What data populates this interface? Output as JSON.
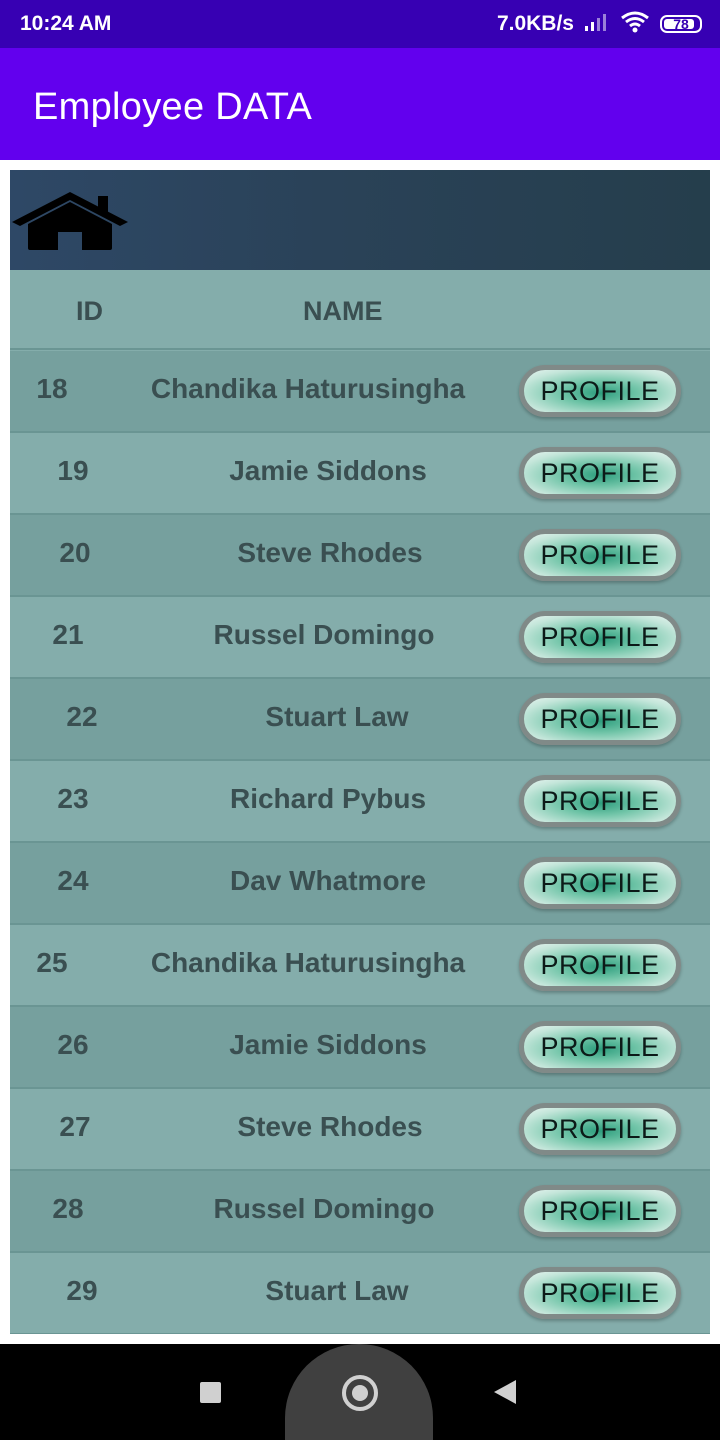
{
  "status_bar": {
    "time": "10:24 AM",
    "net_speed": "7.0KB/s",
    "battery_level": "78",
    "icons": [
      "signal-icon",
      "wifi-icon",
      "battery-icon"
    ]
  },
  "app_bar": {
    "title": "Employee DATA"
  },
  "header": {
    "home_icon": "home-icon"
  },
  "table": {
    "columns": [
      "ID",
      "NAME"
    ],
    "profile_label": "PROFILE",
    "rows": [
      {
        "id": "18",
        "name": "Chandika Haturusingha"
      },
      {
        "id": "19",
        "name": "Jamie Siddons"
      },
      {
        "id": "20",
        "name": "Steve Rhodes"
      },
      {
        "id": "21",
        "name": "Russel Domingo"
      },
      {
        "id": "22",
        "name": "Stuart Law"
      },
      {
        "id": "23",
        "name": "Richard Pybus"
      },
      {
        "id": "24",
        "name": "Dav Whatmore"
      },
      {
        "id": "25",
        "name": "Chandika Haturusingha"
      },
      {
        "id": "26",
        "name": "Jamie Siddons"
      },
      {
        "id": "27",
        "name": "Steve Rhodes"
      },
      {
        "id": "28",
        "name": "Russel Domingo"
      },
      {
        "id": "29",
        "name": "Stuart Law"
      }
    ]
  },
  "nav_bar": {
    "icons": [
      "recents-icon",
      "home-circle-icon",
      "back-icon"
    ]
  },
  "colors": {
    "status_bar": "#3700b3",
    "app_bar": "#6200ee",
    "row_dark": "#76a09e",
    "row_light": "#84adab",
    "text": "#3a4f51"
  }
}
